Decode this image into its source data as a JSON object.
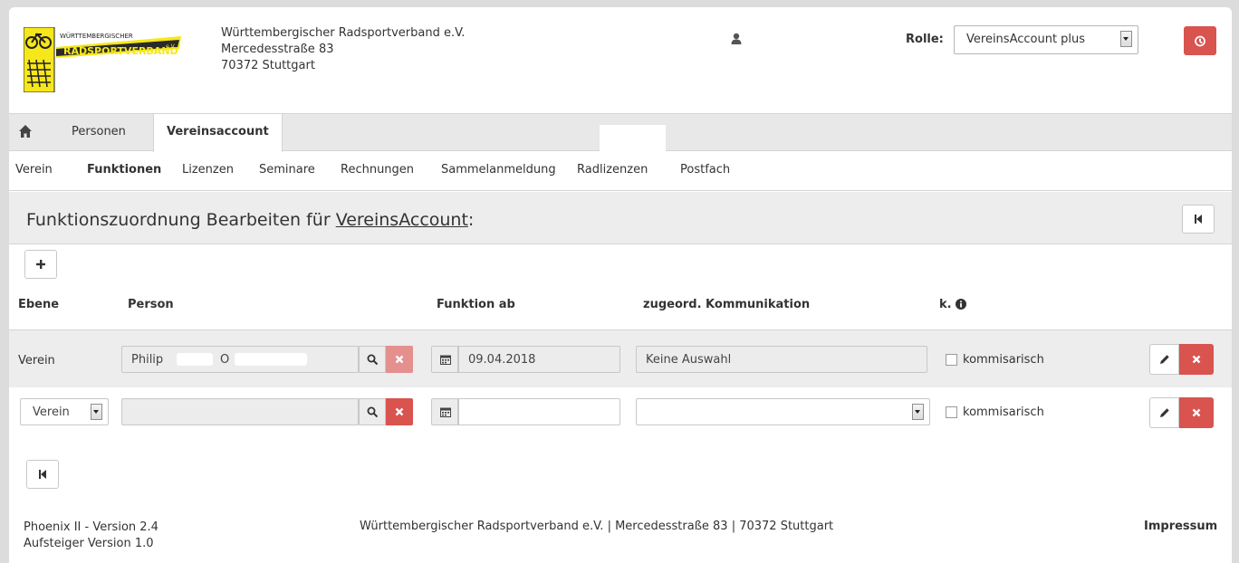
{
  "header": {
    "logo": {
      "line1": "WÜRTTEMBERGISCHER",
      "line2": "RADSPORTVERBAND",
      "suffix": "e.V."
    },
    "address": [
      "Württembergischer Radsportverband e.V.",
      "Mercedesstraße 83",
      "70372 Stuttgart"
    ],
    "role_label": "Rolle:",
    "role_value": "VereinsAccount plus"
  },
  "nav": {
    "tabs": [
      {
        "label": "Personen"
      },
      {
        "label": "Vereinsaccount"
      }
    ]
  },
  "subnav": {
    "items": [
      "Verein",
      "Funktionen",
      "Lizenzen",
      "Seminare",
      "Rechnungen",
      "Sammelanmeldung",
      "Radlizenzen",
      "Postfach"
    ],
    "active": "Funktionen"
  },
  "page": {
    "title_prefix": "Funktionszuordnung Bearbeiten für ",
    "title_link": "VereinsAccount",
    "title_suffix": ":"
  },
  "table": {
    "columns": [
      "Ebene",
      "Person",
      "Funktion ab",
      "zugeord. Kommunikation",
      "k."
    ],
    "rows": [
      {
        "ebene": "Verein",
        "person_first": "Philip",
        "person_initial": "O",
        "funktion_ab": "09.04.2018",
        "kommunikation": "Keine Auswahl",
        "kommisarisch_label": "kommisarisch"
      },
      {
        "ebene": "Verein",
        "person": "",
        "funktion_ab": "",
        "kommunikation": "",
        "kommisarisch_label": "kommisarisch"
      }
    ]
  },
  "footer": {
    "left": [
      "Phoenix II - Version 2.4",
      "Aufsteiger Version 1.0"
    ],
    "center": "Württembergischer Radsportverband e.V. | Mercedesstraße 83 | 70372 Stuttgart",
    "right": "Impressum"
  },
  "colors": {
    "danger": "#d9534f",
    "bar": "#ededed",
    "logo_yellow": "#f6e71a"
  },
  "icons": {
    "home": "home-icon",
    "user": "user-icon",
    "power": "power-icon",
    "back": "skip-back-icon",
    "add": "plus-icon",
    "search": "search-icon",
    "clear": "x-icon",
    "calendar": "calendar-icon",
    "edit": "pencil-icon",
    "info": "info-icon"
  }
}
